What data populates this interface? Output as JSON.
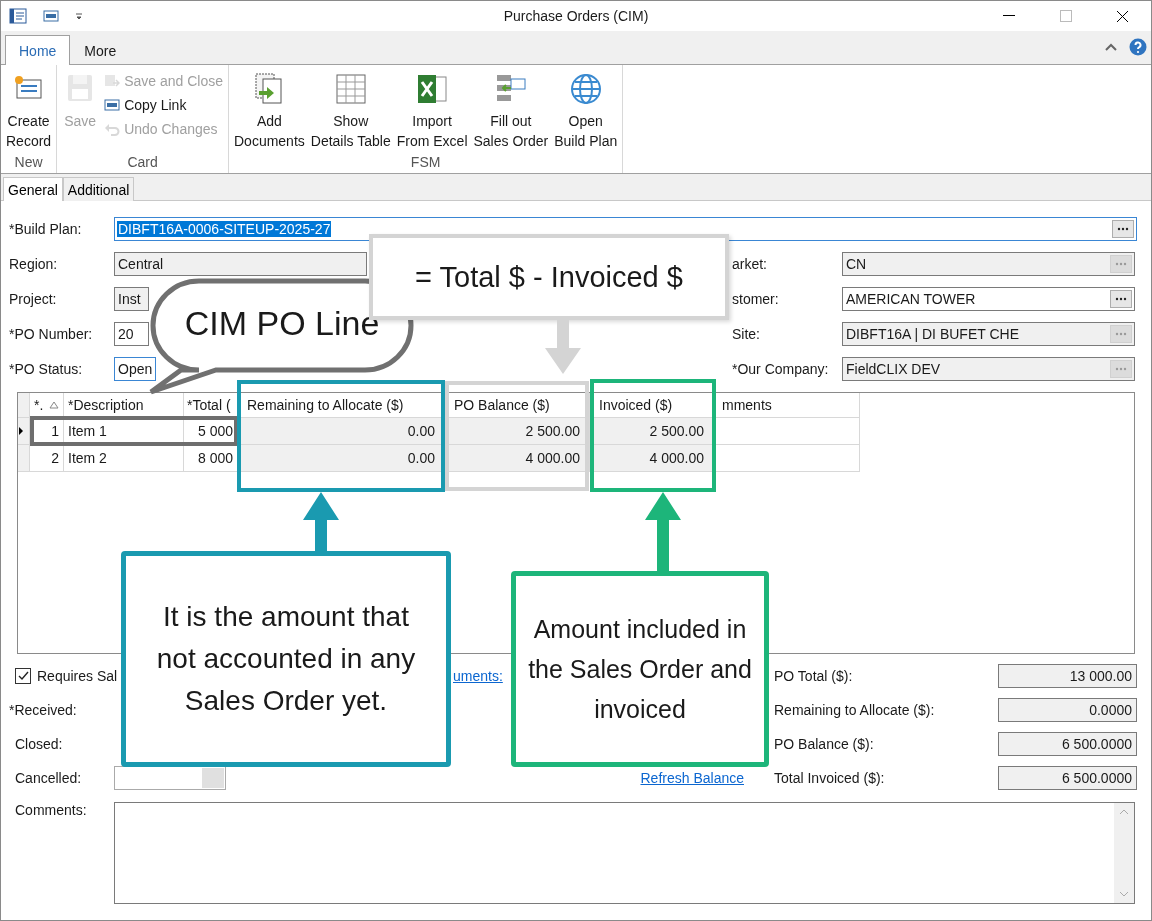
{
  "window": {
    "title": "Purchase Orders (CIM)"
  },
  "ribbon_tabs": [
    {
      "label": "Home",
      "selected": true
    },
    {
      "label": "More",
      "selected": false
    }
  ],
  "ribbon_groups": [
    {
      "label": "New",
      "buttons": [
        {
          "kind": "large",
          "label": "Create\nRecord",
          "disabled": false
        }
      ]
    },
    {
      "label": "Card",
      "buttons": [
        {
          "kind": "large",
          "label": "Save",
          "disabled": true
        },
        {
          "kind": "small",
          "label": "Save and Close",
          "disabled": true
        },
        {
          "kind": "small",
          "label": "Copy Link",
          "disabled": false
        },
        {
          "kind": "small",
          "label": "Undo Changes",
          "disabled": true
        }
      ]
    },
    {
      "label": "FSM",
      "buttons": [
        {
          "kind": "large",
          "label": "Add\nDocuments",
          "disabled": false
        },
        {
          "kind": "large",
          "label": "Show\nDetails Table",
          "disabled": false
        },
        {
          "kind": "large",
          "label": "Import\nFrom Excel",
          "disabled": false
        },
        {
          "kind": "large",
          "label": "Fill out\nSales Order",
          "disabled": false
        },
        {
          "kind": "large",
          "label": "Open\nBuild Plan",
          "disabled": false
        }
      ]
    }
  ],
  "form_tabs": [
    {
      "label": "General",
      "selected": true
    },
    {
      "label": "Additional",
      "selected": false
    }
  ],
  "build_plan": {
    "label": "*Build Plan:",
    "value": "DIBFT16A-0006-SITEUP-2025-27",
    "highlighted": true
  },
  "left_fields": [
    {
      "label": "Region:",
      "value": "Central",
      "readonly": true
    },
    {
      "label": "Project:",
      "value": "Inst",
      "readonly": true
    },
    {
      "label": "*PO Number:",
      "value": "20",
      "readonly": false
    },
    {
      "label": "*PO Status:",
      "value": "Open",
      "readonly": false
    }
  ],
  "right_fields": [
    {
      "label": "arket:",
      "value": "CN",
      "readonly": true
    },
    {
      "label": "stomer:",
      "value": "AMERICAN TOWER",
      "readonly": false
    },
    {
      "label": "Site:",
      "value": "DIBFT16A | DI BUFET CHE",
      "readonly": true
    },
    {
      "label": "*Our Company:",
      "value": "FieldCLIX DEV",
      "readonly": true
    }
  ],
  "grid": {
    "columns": [
      "*.",
      "*Description",
      "*Total (",
      "Remaining to Allocate ($)",
      "PO Balance ($)",
      "Invoiced ($)",
      "mments"
    ],
    "rows": [
      {
        "current": true,
        "cells": [
          "1",
          "Item 1",
          "5 000",
          "0.00",
          "2 500.00",
          "2 500.00"
        ]
      },
      {
        "current": false,
        "cells": [
          "2",
          "Item 2",
          "8 000",
          "0.00",
          "4 000.00",
          "4 000.00"
        ]
      }
    ]
  },
  "requires": {
    "label": "Requires Sal",
    "checked": true
  },
  "documents_link": "uments:",
  "bottom_labels": [
    "*Received:",
    "Closed:",
    "Cancelled:"
  ],
  "refresh_link": "Refresh Balance",
  "totals": [
    {
      "label": "PO Total ($):",
      "value": "13 000.00"
    },
    {
      "label": "Remaining to Allocate ($):",
      "value": "0.0000"
    },
    {
      "label": "PO Balance ($):",
      "value": "6 500.0000"
    },
    {
      "label": "Total Invoiced ($):",
      "value": "6 500.0000"
    }
  ],
  "comments": {
    "label": "Comments:"
  },
  "annotations": {
    "bubble": "CIM PO Line",
    "formula": "= Total $ - Invoiced $",
    "remaining_note": "It is the amount that not accounted in any Sales Order yet.",
    "invoiced_note": "Amount included in the Sales Order and invoiced"
  }
}
